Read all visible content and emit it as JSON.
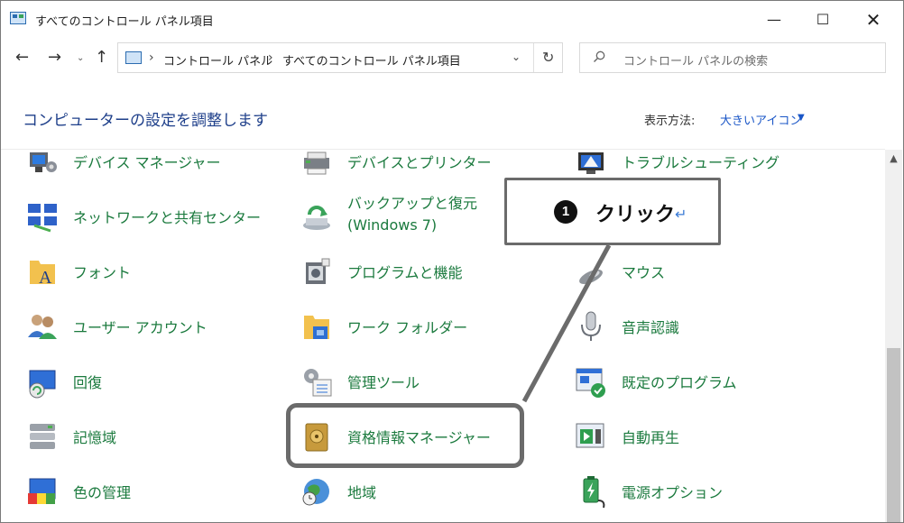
{
  "window": {
    "title": "すべてのコントロール パネル項目",
    "minimize": "—",
    "maximize": "☐",
    "close": "✕"
  },
  "nav": {
    "back": "←",
    "forward": "→",
    "recent": "⌄",
    "up": "↑",
    "breadcrumb": [
      "コントロール パネル",
      "すべてのコントロール パネル項目"
    ],
    "separator": "›",
    "refresh": "↻",
    "dropdown": "⌄",
    "search_placeholder": "コントロール パネルの検索"
  },
  "header": {
    "title": "コンピューターの設定を調整します",
    "view_by_label": "表示方法:",
    "view_by_value": "大きいアイコン",
    "caret": "▼"
  },
  "items": [
    {
      "label": "デバイス マネージャー",
      "icon": "device-manager-icon"
    },
    {
      "label": "デバイスとプリンター",
      "icon": "devices-printers-icon"
    },
    {
      "label": "トラブルシューティング",
      "icon": "troubleshooting-icon"
    },
    {
      "label": "ネットワークと共有センター",
      "icon": "network-icon"
    },
    {
      "label": "バックアップと復元 (Windows 7)",
      "icon": "backup-icon"
    },
    {
      "label": "フォント",
      "icon": "fonts-icon"
    },
    {
      "label": "プログラムと機能",
      "icon": "programs-icon"
    },
    {
      "label": "マウス",
      "icon": "mouse-icon"
    },
    {
      "label": "ユーザー アカウント",
      "icon": "user-accounts-icon"
    },
    {
      "label": "ワーク フォルダー",
      "icon": "work-folders-icon"
    },
    {
      "label": "音声認識",
      "icon": "microphone-icon"
    },
    {
      "label": "回復",
      "icon": "recovery-icon"
    },
    {
      "label": "管理ツール",
      "icon": "admin-tools-icon"
    },
    {
      "label": "既定のプログラム",
      "icon": "default-programs-icon"
    },
    {
      "label": "記憶域",
      "icon": "storage-icon"
    },
    {
      "label": "資格情報マネージャー",
      "icon": "credential-manager-icon"
    },
    {
      "label": "自動再生",
      "icon": "autoplay-icon"
    },
    {
      "label": "色の管理",
      "icon": "color-management-icon"
    },
    {
      "label": "地域",
      "icon": "region-icon"
    },
    {
      "label": "電源オプション",
      "icon": "power-options-icon"
    }
  ],
  "scrollbar": {
    "up": "▲"
  },
  "annotation": {
    "number": "1",
    "text": "クリック",
    "return_mark": "↵"
  }
}
